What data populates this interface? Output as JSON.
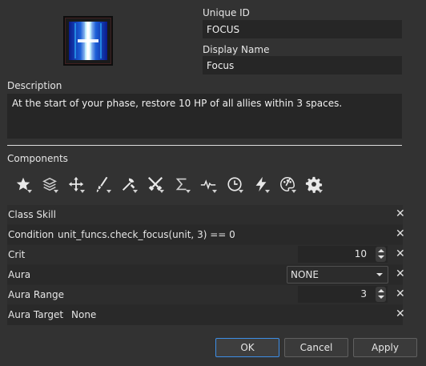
{
  "skill": {
    "unique_id_label": "Unique ID",
    "unique_id_value": "FOCUS",
    "display_name_label": "Display Name",
    "display_name_value": "Focus",
    "description_label": "Description",
    "description_value": "At the start of your phase, restore 10 HP of all allies within 3 spaces.",
    "icon": "blue-light-burst-icon"
  },
  "components": {
    "label": "Components",
    "toolbar": [
      {
        "name": "star-icon"
      },
      {
        "name": "layers-icon"
      },
      {
        "name": "move-arrows-icon"
      },
      {
        "name": "sword-icon"
      },
      {
        "name": "axe-wrench-icon"
      },
      {
        "name": "crossed-swords-icon"
      },
      {
        "name": "sigma-icon"
      },
      {
        "name": "pulse-icon"
      },
      {
        "name": "clock-icon"
      },
      {
        "name": "lightning-icon"
      },
      {
        "name": "palette-icon"
      },
      {
        "name": "gear-icon"
      }
    ],
    "rows": [
      {
        "name": "Class Skill"
      },
      {
        "name": "Condition",
        "value": "unit_funcs.check_focus(unit, 3) == 0"
      },
      {
        "name": "Crit",
        "value": "10"
      },
      {
        "name": "Aura",
        "value": "NONE"
      },
      {
        "name": "Aura Range",
        "value": "3"
      },
      {
        "name": "Aura Target",
        "value": "None"
      }
    ],
    "remove_glyph": "✕"
  },
  "buttons": {
    "ok": "OK",
    "cancel": "Cancel",
    "apply": "Apply"
  },
  "colors": {
    "background": "#323232",
    "field": "#262626",
    "ok_border": "#3d8ee6"
  }
}
